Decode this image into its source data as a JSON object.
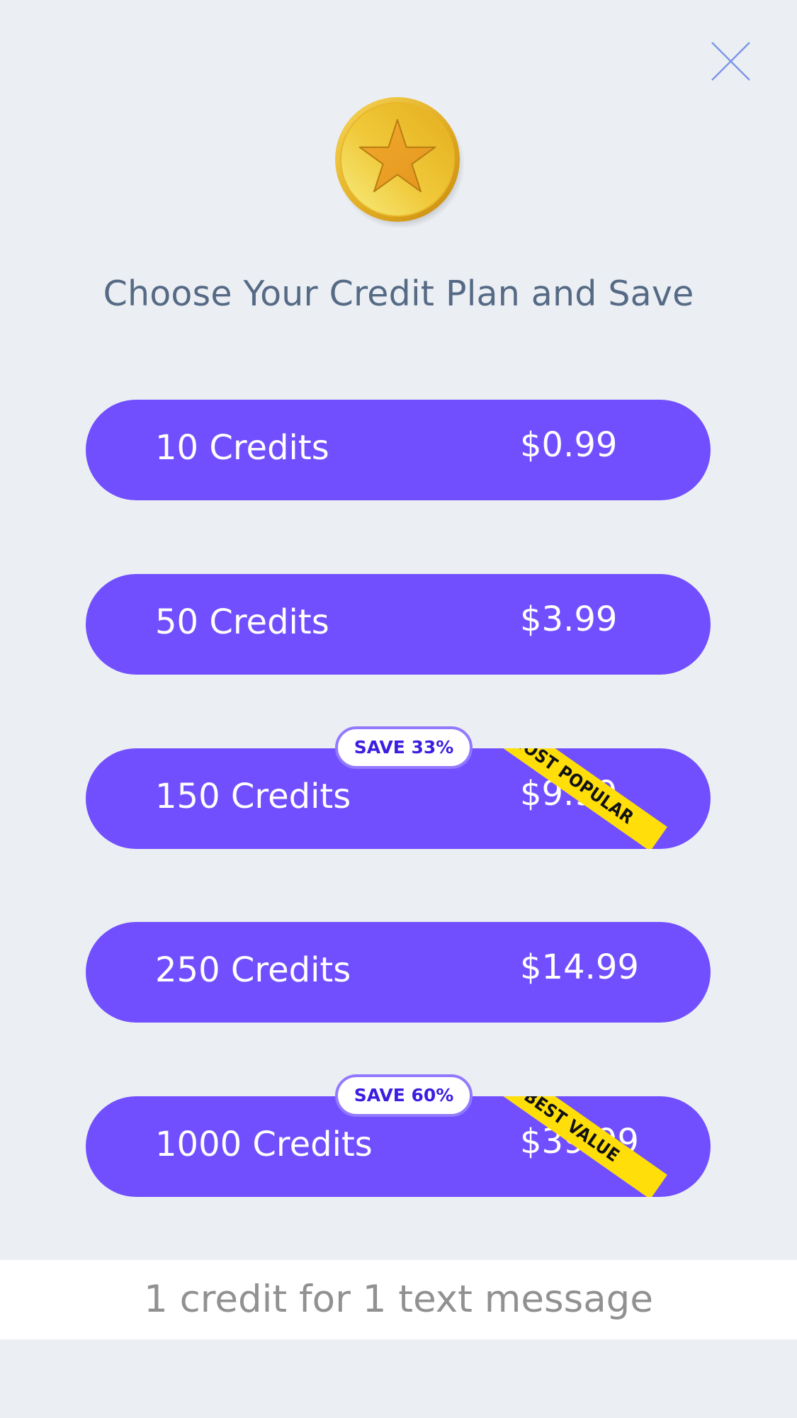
{
  "title": "Choose Your Credit Plan and Save",
  "plans": [
    {
      "name": "10 Credits",
      "price": "$0.99"
    },
    {
      "name": "50 Credits",
      "price": "$3.99"
    },
    {
      "name": "150 Credits",
      "price": "$9.99",
      "badge": "SAVE 33%",
      "ribbon": "MOST POPULAR"
    },
    {
      "name": "250 Credits",
      "price": "$14.99"
    },
    {
      "name": "1000 Credits",
      "price": "$39.99",
      "badge": "SAVE 60%",
      "ribbon": "BEST VALUE"
    }
  ],
  "footer": "1 credit for 1 text message",
  "icons": {
    "close": "close-icon",
    "coin": "star-coin-icon"
  },
  "colors": {
    "background": "#ebeff4",
    "plan_button": "#714fff",
    "ribbon": "#ffde0a",
    "badge_text": "#3b1ee0",
    "badge_border": "#9379ff",
    "title": "#566a85",
    "footer_text": "#919191",
    "close_icon": "#7d97e6"
  }
}
